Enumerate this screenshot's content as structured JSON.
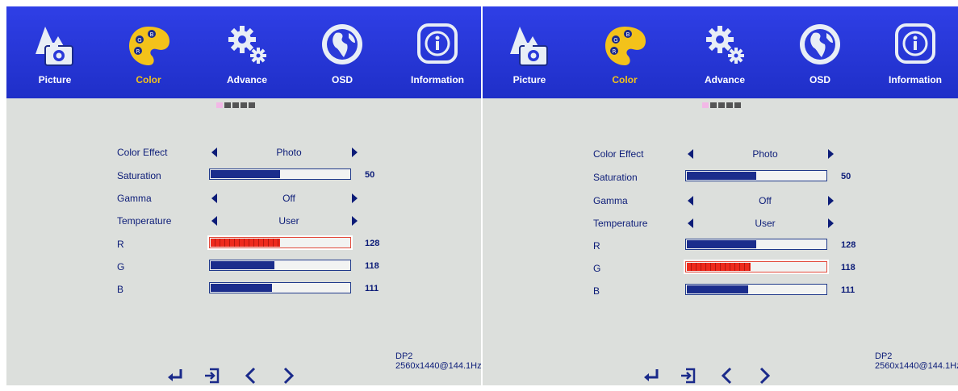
{
  "colors": {
    "menu_bar": "#2a3ad9",
    "active_tab_label": "#f3c21a",
    "text": "#0c1c78",
    "bar_fill": "#1b2d8c",
    "selected_bar_fill": "#ee2a1c"
  },
  "panels": [
    {
      "tabs": [
        {
          "label": "Picture",
          "icon": "picture-icon",
          "active": false
        },
        {
          "label": "Color",
          "icon": "palette-icon",
          "active": true
        },
        {
          "label": "Advance",
          "icon": "gears-icon",
          "active": false
        },
        {
          "label": "OSD",
          "icon": "globe-icon",
          "active": false
        },
        {
          "label": "Information",
          "icon": "info-icon",
          "active": false
        }
      ],
      "page_indicator": {
        "pages": 5,
        "current": 1
      },
      "settings": {
        "color_effect": {
          "label": "Color Effect",
          "value": "Photo"
        },
        "saturation": {
          "label": "Saturation",
          "value": "50",
          "level": 0.5
        },
        "gamma": {
          "label": "Gamma",
          "value": "Off"
        },
        "temperature": {
          "label": "Temperature",
          "value": "User"
        },
        "r": {
          "label": "R",
          "value": "128",
          "level": 0.5,
          "selected": true
        },
        "g": {
          "label": "G",
          "value": "118",
          "level": 0.46,
          "selected": false
        },
        "b": {
          "label": "B",
          "value": "111",
          "level": 0.44,
          "selected": false
        }
      },
      "nav_icons": [
        "enter-icon",
        "exit-icon",
        "chevron-left-icon",
        "chevron-right-icon"
      ],
      "status": {
        "input": "DP2",
        "resolution": "2560x1440@144.1Hz"
      }
    },
    {
      "tabs": [
        {
          "label": "Picture",
          "icon": "picture-icon",
          "active": false
        },
        {
          "label": "Color",
          "icon": "palette-icon",
          "active": true
        },
        {
          "label": "Advance",
          "icon": "gears-icon",
          "active": false
        },
        {
          "label": "OSD",
          "icon": "globe-icon",
          "active": false
        },
        {
          "label": "Information",
          "icon": "info-icon",
          "active": false
        }
      ],
      "page_indicator": {
        "pages": 5,
        "current": 1
      },
      "settings": {
        "color_effect": {
          "label": "Color Effect",
          "value": "Photo"
        },
        "saturation": {
          "label": "Saturation",
          "value": "50",
          "level": 0.5
        },
        "gamma": {
          "label": "Gamma",
          "value": "Off"
        },
        "temperature": {
          "label": "Temperature",
          "value": "User"
        },
        "r": {
          "label": "R",
          "value": "128",
          "level": 0.5,
          "selected": false
        },
        "g": {
          "label": "G",
          "value": "118",
          "level": 0.46,
          "selected": true
        },
        "b": {
          "label": "B",
          "value": "111",
          "level": 0.44,
          "selected": false
        }
      },
      "nav_icons": [
        "enter-icon",
        "exit-icon",
        "chevron-left-icon",
        "chevron-right-icon"
      ],
      "status": {
        "input": "DP2",
        "resolution": "2560x1440@144.1Hz"
      }
    }
  ]
}
